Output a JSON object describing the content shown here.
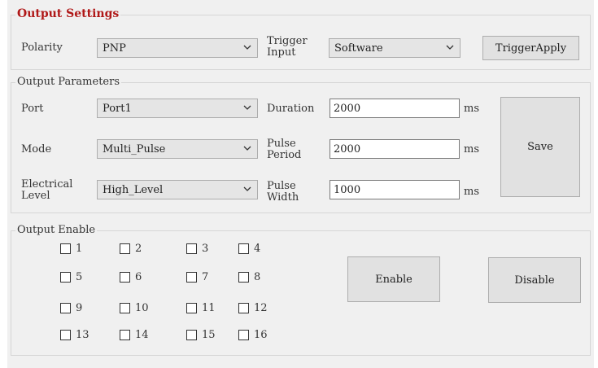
{
  "output_settings": {
    "title": "Output Settings",
    "polarity_label": "Polarity",
    "polarity_value": "PNP",
    "trigger_input_label": "Trigger\nInput",
    "trigger_input_value": "Software",
    "trigger_apply_label": "TriggerApply"
  },
  "output_parameters": {
    "title": "Output Parameters",
    "port_label": "Port",
    "port_value": "Port1",
    "mode_label": "Mode",
    "mode_value": "Multi_Pulse",
    "electrical_level_label": "Electrical\nLevel",
    "electrical_level_value": "High_Level",
    "duration_label": "Duration",
    "duration_value": "2000",
    "duration_unit": "ms",
    "pulse_period_label": "Pulse\nPeriod",
    "pulse_period_value": "2000",
    "pulse_period_unit": "ms",
    "pulse_width_label": "Pulse\nWidth",
    "pulse_width_value": "1000",
    "pulse_width_unit": "ms",
    "save_label": "Save"
  },
  "output_enable": {
    "title": "Output Enable",
    "channels": [
      "1",
      "2",
      "3",
      "4",
      "5",
      "6",
      "7",
      "8",
      "9",
      "10",
      "11",
      "12",
      "13",
      "14",
      "15",
      "16"
    ],
    "enable_label": "Enable",
    "disable_label": "Disable"
  },
  "icons": {
    "dropdown": "chevron-down-icon",
    "checkbox": "checkbox-unchecked"
  },
  "colors": {
    "title_red": "#b01818",
    "panel_bg": "#f0f0f0",
    "button_bg": "#e1e1e1"
  }
}
